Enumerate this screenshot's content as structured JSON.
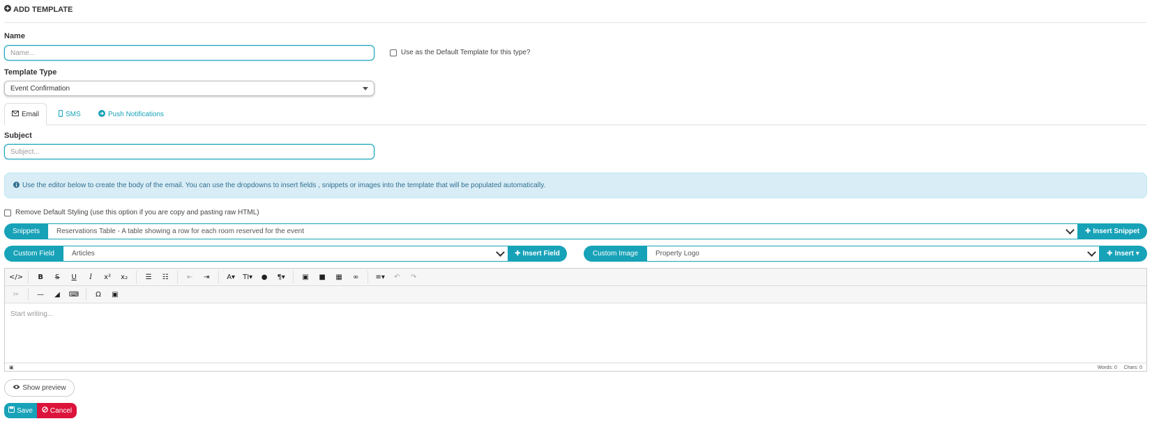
{
  "header": {
    "title": "ADD TEMPLATE",
    "icon": "plus-circle-icon"
  },
  "name_field": {
    "label": "Name",
    "placeholder": "Name..."
  },
  "default_checkbox": {
    "label": "Use as the Default Template for this type?",
    "checked": false
  },
  "template_type": {
    "label": "Template Type",
    "selected": "Event Confirmation"
  },
  "tabs": [
    {
      "label": "Email",
      "icon": "envelope-icon",
      "active": true
    },
    {
      "label": "SMS",
      "icon": "mobile-icon",
      "active": false
    },
    {
      "label": "Push Notifications",
      "icon": "arrow-circle-icon",
      "active": false
    }
  ],
  "subject_field": {
    "label": "Subject",
    "placeholder": "Subject..."
  },
  "info": {
    "text": "Use the editor below to create the body of the email. You can use the dropdowns to insert fields , snippets or images into the template that will be populated automatically.",
    "icon": "info-circle-icon"
  },
  "remove_styling": {
    "label": "Remove Default Styling (use this option if you are copy and pasting raw HTML)",
    "checked": false
  },
  "snippets": {
    "label": "Snippets",
    "selected": "Reservations Table - A table showing a row for each room reserved for the event",
    "button": "Insert Snippet"
  },
  "custom_field": {
    "label": "Custom Field",
    "selected": "Articles",
    "button": "Insert Field"
  },
  "custom_image": {
    "label": "Custom Image",
    "selected": "Property Logo",
    "button": "Insert"
  },
  "editor": {
    "placeholder": "Start writing...",
    "words": "Words: 0",
    "chars": "Chars: 0"
  },
  "buttons": {
    "preview": "Show preview",
    "save": "Save",
    "cancel": "Cancel"
  },
  "colors": {
    "accent": "#17a2b8",
    "danger": "#dc143c",
    "info_bg": "#d9edf7",
    "info_text": "#31708f"
  }
}
